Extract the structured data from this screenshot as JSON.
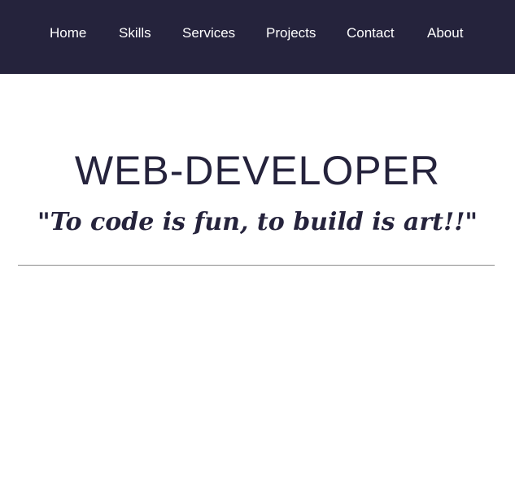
{
  "nav": {
    "items": [
      {
        "label": "Home"
      },
      {
        "label": "Skills"
      },
      {
        "label": "Services"
      },
      {
        "label": "Projects"
      },
      {
        "label": "Contact"
      },
      {
        "label": "About"
      }
    ]
  },
  "hero": {
    "title": "WEB-DEVELOPER",
    "tagline": "\"To code is fun, to build is art!!\""
  },
  "colors": {
    "navbar_background": "#25233c",
    "nav_text": "#ffffff",
    "heading_text": "#25233c",
    "divider": "#8a8a8a"
  }
}
